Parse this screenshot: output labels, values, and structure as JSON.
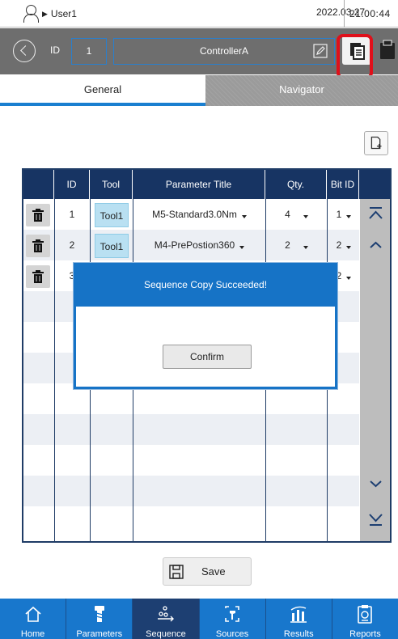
{
  "status": {
    "user": "User1",
    "date": "2022.03.27",
    "time": "21:00:44"
  },
  "header": {
    "id_label": "ID",
    "id_value": "1",
    "controller_name": "ControllerA"
  },
  "tabs": [
    {
      "label": "General"
    },
    {
      "label": "Navigator"
    }
  ],
  "table": {
    "headers": [
      "ID",
      "Tool",
      "Parameter Title",
      "Qty.",
      "Bit ID"
    ],
    "rows": [
      {
        "id": "1",
        "tool": "Tool1",
        "param": "M5-Standard3.0Nm",
        "qty": "4",
        "bit": "1"
      },
      {
        "id": "2",
        "tool": "Tool1",
        "param": "M4-PrePostion360",
        "qty": "2",
        "bit": "2"
      },
      {
        "id": "3",
        "tool": "",
        "param": "",
        "qty": "",
        "bit": "2"
      }
    ]
  },
  "dialog": {
    "title": "Sequence Copy Succeeded!",
    "confirm_label": "Confirm"
  },
  "save_label": "Save",
  "nav": [
    {
      "label": "Home",
      "icon": "home-icon"
    },
    {
      "label": "Parameters",
      "icon": "screw-icon"
    },
    {
      "label": "Sequence",
      "icon": "sequence-icon"
    },
    {
      "label": "Sources",
      "icon": "sources-icon"
    },
    {
      "label": "Results",
      "icon": "results-icon"
    },
    {
      "label": "Reports",
      "icon": "reports-icon"
    }
  ],
  "colors": {
    "header": "#6e6e6e",
    "accent": "#1673c6",
    "table_head": "#173463",
    "nav": "#1877cc",
    "nav_active": "#1d3f72",
    "highlight": "#e0101a"
  }
}
